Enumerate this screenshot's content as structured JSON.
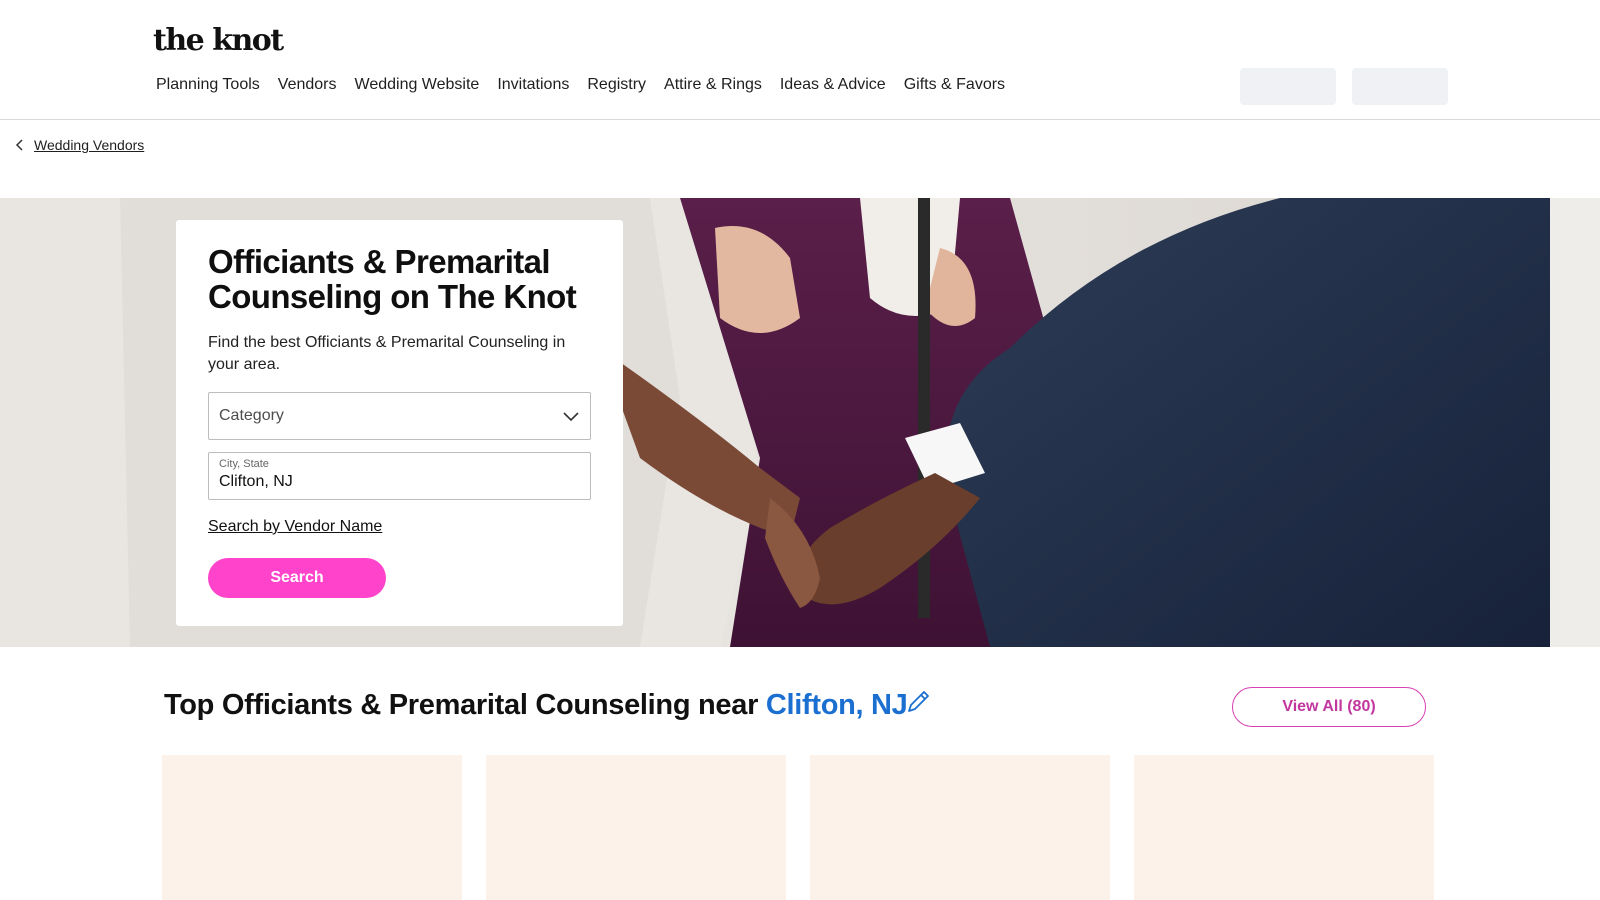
{
  "header": {
    "logo": "the knot",
    "nav": [
      "Planning Tools",
      "Vendors",
      "Wedding Website",
      "Invitations",
      "Registry",
      "Attire & Rings",
      "Ideas & Advice",
      "Gifts & Favors"
    ]
  },
  "breadcrumb": {
    "label": "Wedding Vendors",
    "icon": "chevron-left-icon"
  },
  "search_card": {
    "title": "Officiants & Premarital Counseling on The Knot",
    "subtitle": "Find the best Officiants & Premarital Counseling in your area.",
    "category_placeholder": "Category",
    "location_label": "City, State",
    "location_value": "Clifton, NJ",
    "vendor_name_link": "Search by Vendor Name",
    "search_button": "Search"
  },
  "results": {
    "title_prefix": "Top Officiants & Premarital Counseling near",
    "location": "Clifton, NJ",
    "view_all": "View All (80)"
  },
  "colors": {
    "accent_pink": "#ff44cb",
    "link_blue": "#1a6fd0",
    "card_placeholder": "#fdf2ea"
  }
}
